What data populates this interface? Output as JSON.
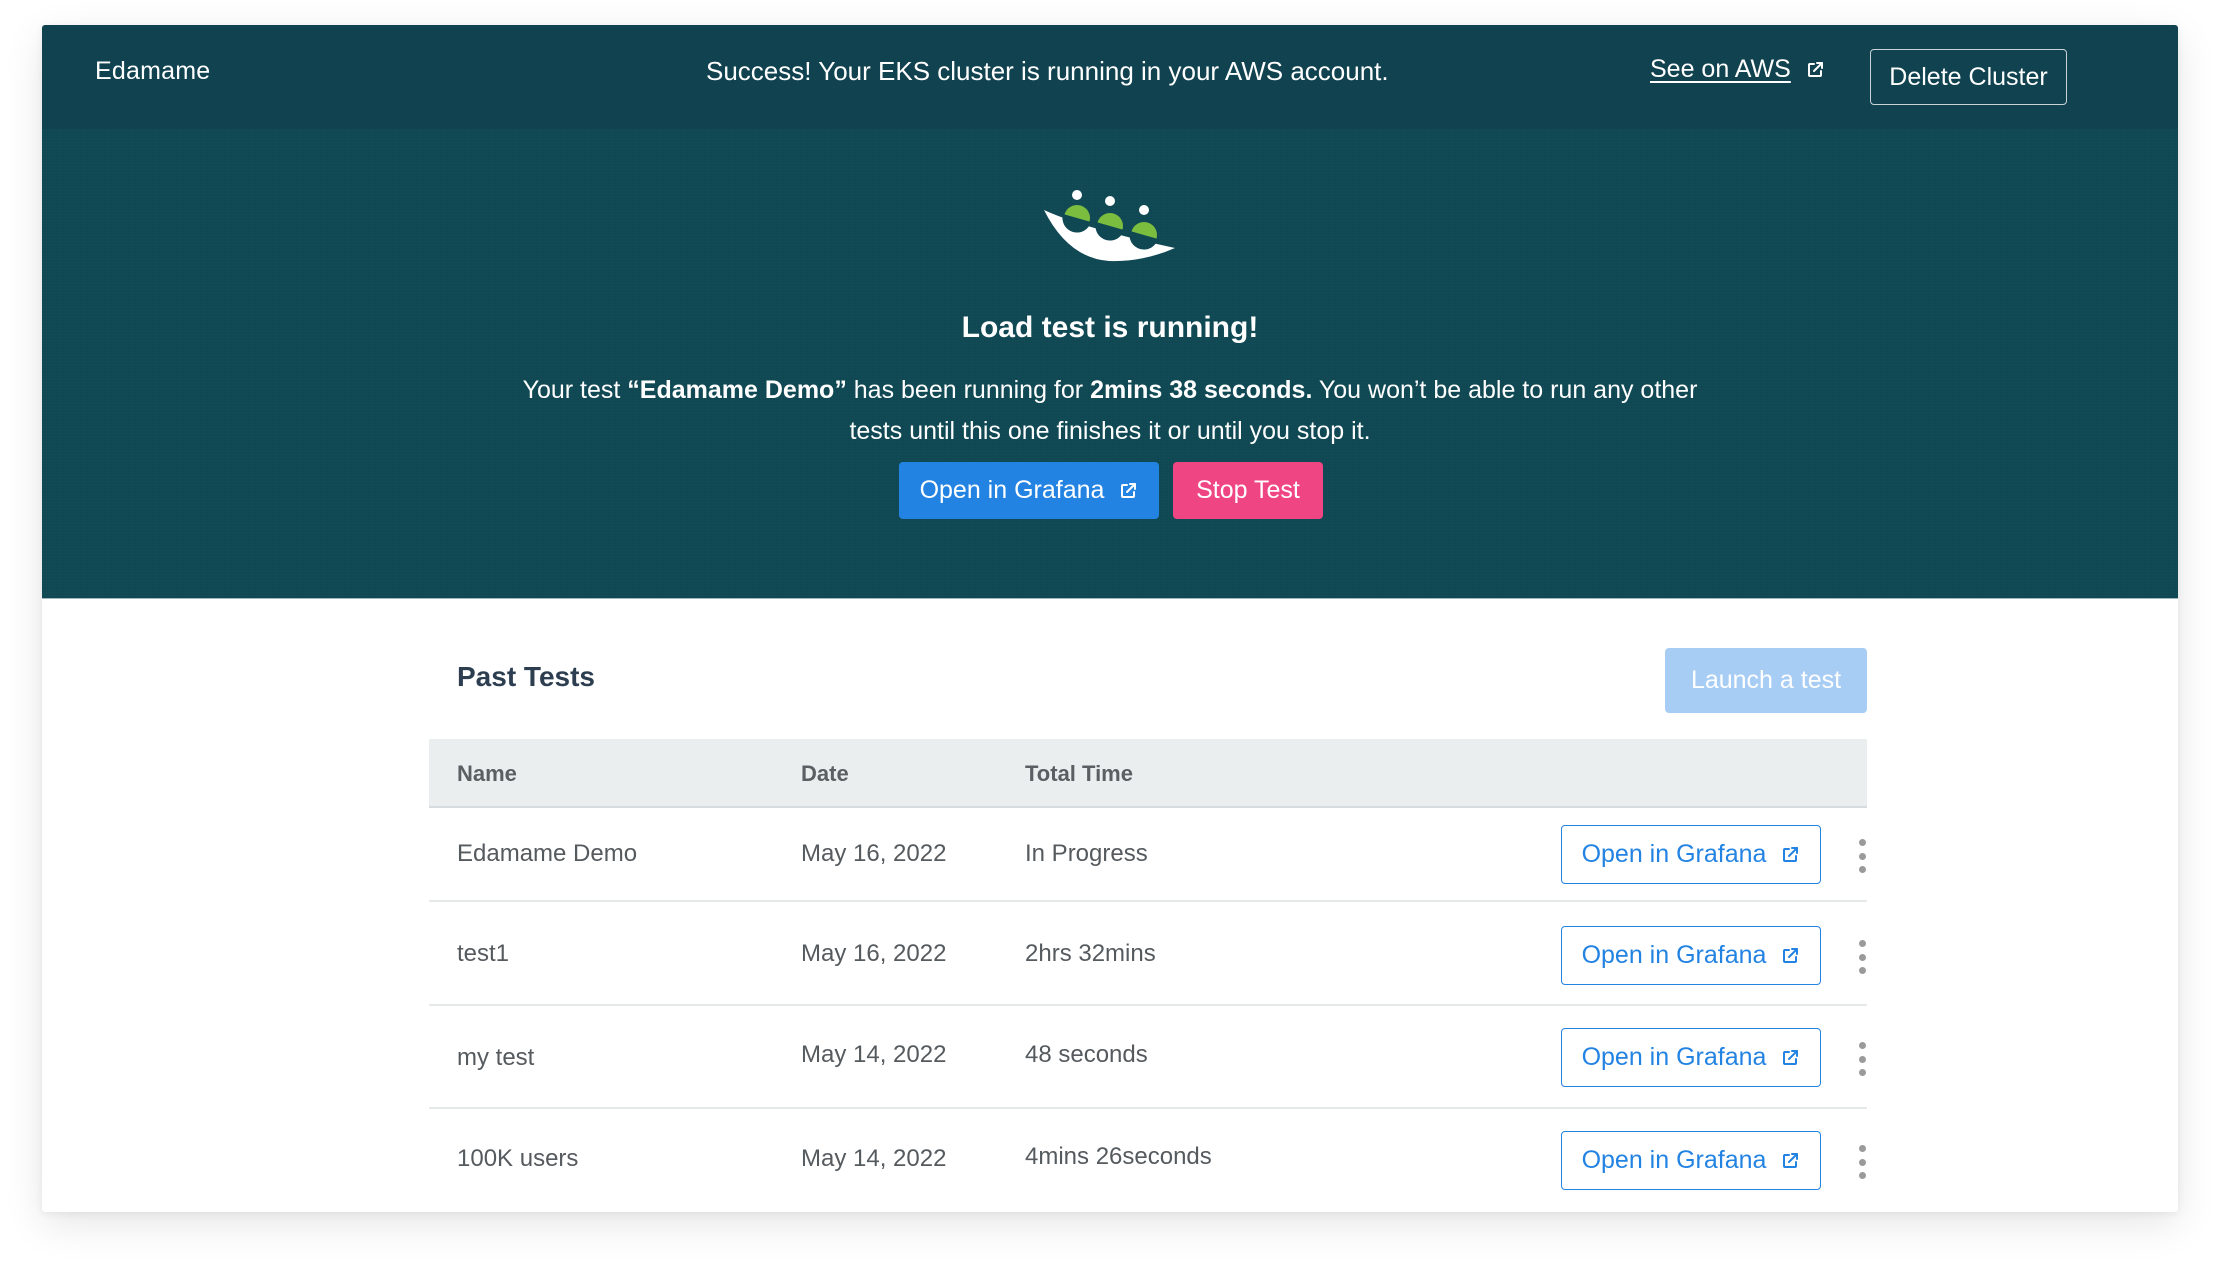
{
  "topbar": {
    "brand": "Edamame",
    "banner_bold": "Success!",
    "banner_rest": " Your EKS cluster is running in your AWS account.",
    "aws_link": "See on AWS",
    "aws_link_icon": "external-link-icon",
    "delete_button": "Delete Cluster"
  },
  "hero": {
    "logo_icon": "edamame-logo-icon",
    "title": "Load test is running!",
    "text_1": "Your test ",
    "test_name": "“Edamame Demo”",
    "text_2": " has been running for ",
    "elapsed": "2mins 38 seconds.",
    "text_3": " You won’t be able to run any other tests until this one finishes it or until you stop it.",
    "open_grafana": "Open in Grafana",
    "open_grafana_icon": "external-link-icon",
    "stop_test": "Stop Test"
  },
  "past_tests": {
    "title": "Past Tests",
    "launch_button": "Launch a test",
    "columns": [
      "Name",
      "Date",
      "Total Time"
    ],
    "rows": [
      {
        "name": "Edamame Demo",
        "date": "May 16, 2022",
        "total_time": "In Progress",
        "action": "Open in Grafana"
      },
      {
        "name": "test1",
        "date": "May 16, 2022",
        "total_time": "2hrs 32mins",
        "action": "Open in Grafana"
      },
      {
        "name": "my test",
        "date": "May 14, 2022",
        "total_time": "48 seconds",
        "action": "Open in Grafana"
      },
      {
        "name": "100K users",
        "date": "May 14, 2022",
        "total_time": "4mins 26seconds",
        "action": "Open in Grafana"
      }
    ],
    "row_menu_icon": "kebab-menu-icon"
  },
  "colors": {
    "topbar_bg": "#10424f",
    "hero_bg": "#0f4853",
    "primary_blue": "#2383e2",
    "stop_pink": "#ef4582",
    "launch_disabled": "#a8cdf4",
    "logo_green": "#7bbd3f"
  }
}
